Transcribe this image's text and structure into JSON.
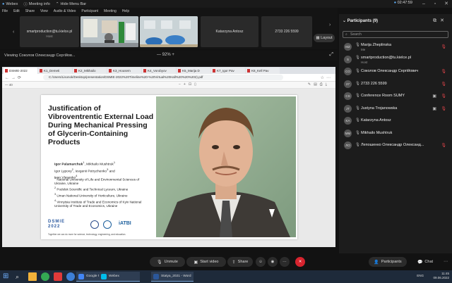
{
  "titlebar": {
    "app": "Webex",
    "meeting_info": "Meeting info",
    "hide_menu": "Hide Menu Bar",
    "clock": "02:47:59"
  },
  "menu": [
    "File",
    "Edit",
    "Share",
    "View",
    "Audio & Video",
    "Participant",
    "Meeting",
    "Help"
  ],
  "strip": {
    "tile1_name": "smartproduction@tu.kielce.pl",
    "tile1_sub": "Host",
    "tile4_name": "Katarzyna Antosz",
    "tile5_name": "2733 226 5599",
    "layout": "Layout"
  },
  "viewbar": {
    "viewing": "Viewing Соколов Олександр Сергійов...",
    "zoom": "—  92%  +"
  },
  "browser": {
    "tabs": [
      "DSMIE-2022",
      "K1_Demeti",
      "K2_Mikhailo",
      "K3_Housem",
      "K4_Vorobyov",
      "K5_Marija D",
      "K7_Igor Pav",
      "K8_Kell Pav"
    ],
    "url": "C:/Users/Lisonok/Desktop/presentation/DSMIE-2022%20Timeline%20-%20Virtual%20Hall%20%20%202).pdf",
    "page": "— 40"
  },
  "slide": {
    "title": "Justification of Vibroventrentic External Load During Mechanical Pressing of Glycerin-Containing Products",
    "authors_line1": "Igor Palamarchuk",
    "authors_line2": ", Mikhailo Mushtruk",
    "authors_line3": "Igor Lypovy",
    "authors_line4": ", Ievgenii Petrychenko",
    "authors_line5": " and",
    "authors_line6": "Ivan Vlasenko",
    "aff1": "National University of Life and Environmental Sciences of Ukraine, Ukraine",
    "aff2": "Podolsk Scientific and Technical Lyceum, Ukraine",
    "aff3": "Uman National University of Horticulture, Ukraine",
    "aff4": "Vinnytsia Institute of Trade and Economics of Kyiv National University of Trade and Economics, Ukraine",
    "sup1": "1",
    "sup2": "2",
    "sup3": "3",
    "sup4": "4",
    "logo_dsmie_1": "DSMIE",
    "logo_dsmie_2": "2022",
    "logo_atbi": "iATBI",
    "tagline": "Together we can do more for science, technology, engineering, and education."
  },
  "controls": {
    "unmute": "Unmute",
    "start_video": "Start video",
    "share": "Share",
    "participants": "Participants",
    "chat": "Chat"
  },
  "panel": {
    "title": "Participants (9)",
    "search_placeholder": "Search",
    "people": [
      {
        "initials": "MZ",
        "name": "Marija Zheplinska",
        "sub": "Me",
        "mic": true
      },
      {
        "initials": "S",
        "name": "smartproduction@tu.kielce.pl",
        "sub": "Host",
        "mic": false
      },
      {
        "initials": "СО",
        "name": "Соколов Олександр Сергійович",
        "sub": "",
        "mic": true
      },
      {
        "initials": "27",
        "name": "2733 226 5599",
        "sub": "",
        "mic": true
      },
      {
        "initials": "CS",
        "name": "Conference Room SUMY",
        "sub": "",
        "mic": true
      },
      {
        "initials": "JT",
        "name": "Justyna Trojanowska",
        "sub": "",
        "mic": true
      },
      {
        "initials": "KA",
        "name": "Katarzyna Antosz",
        "sub": "",
        "mic": false
      },
      {
        "initials": "MM",
        "name": "Mikhailo Mushtruk",
        "sub": "",
        "mic": false
      },
      {
        "initials": "ЛО",
        "name": "Лепошенко Олександр Олександ...",
        "sub": "",
        "mic": true
      }
    ]
  },
  "taskbar": {
    "app1": "Google Переводч...",
    "app2": "Webex",
    "app3": "Statya_2021 - Word",
    "lang": "ENG",
    "time": "11:45",
    "date": "09.06.2022"
  },
  "colors": {
    "leave": "#d7242e",
    "mic_muted": "#e2454a",
    "panel_bg": "#1c1c1c",
    "taskbar": "#1e2a3a"
  }
}
